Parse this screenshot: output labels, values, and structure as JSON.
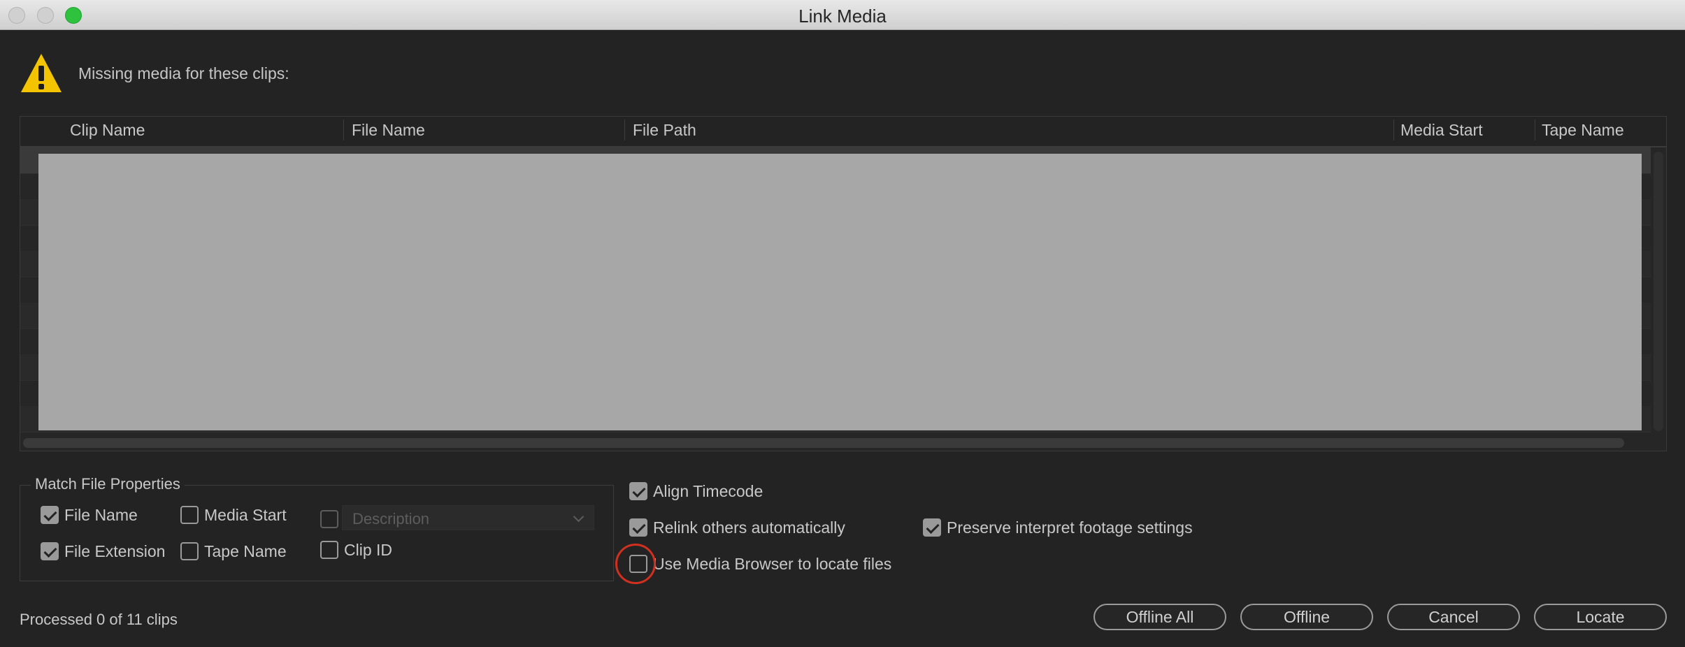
{
  "window": {
    "title": "Link Media"
  },
  "message": "Missing media for these clips:",
  "table": {
    "columns": [
      "Clip Name",
      "File Name",
      "File Path",
      "Media Start",
      "Tape Name"
    ]
  },
  "match_props": {
    "legend": "Match File Properties",
    "file_name": {
      "label": "File Name",
      "checked": true
    },
    "file_extension": {
      "label": "File Extension",
      "checked": true
    },
    "media_start": {
      "label": "Media Start",
      "checked": false
    },
    "tape_name": {
      "label": "Tape Name",
      "checked": false
    },
    "description": {
      "label": "Description",
      "checked": false
    },
    "clip_id": {
      "label": "Clip ID",
      "checked": false
    }
  },
  "options": {
    "align_timecode": {
      "label": "Align Timecode",
      "checked": true
    },
    "relink_auto": {
      "label": "Relink others automatically",
      "checked": true
    },
    "use_media_browser": {
      "label": "Use Media Browser to locate files",
      "checked": false
    },
    "preserve_interpret": {
      "label": "Preserve interpret footage settings",
      "checked": true
    }
  },
  "status": "Processed 0 of 11 clips",
  "buttons": {
    "offline_all": "Offline All",
    "offline": "Offline",
    "cancel": "Cancel",
    "locate": "Locate"
  },
  "colors": {
    "accent_highlight": "#d0301f",
    "warning": "#f5c400",
    "max_button": "#2fc23f"
  }
}
